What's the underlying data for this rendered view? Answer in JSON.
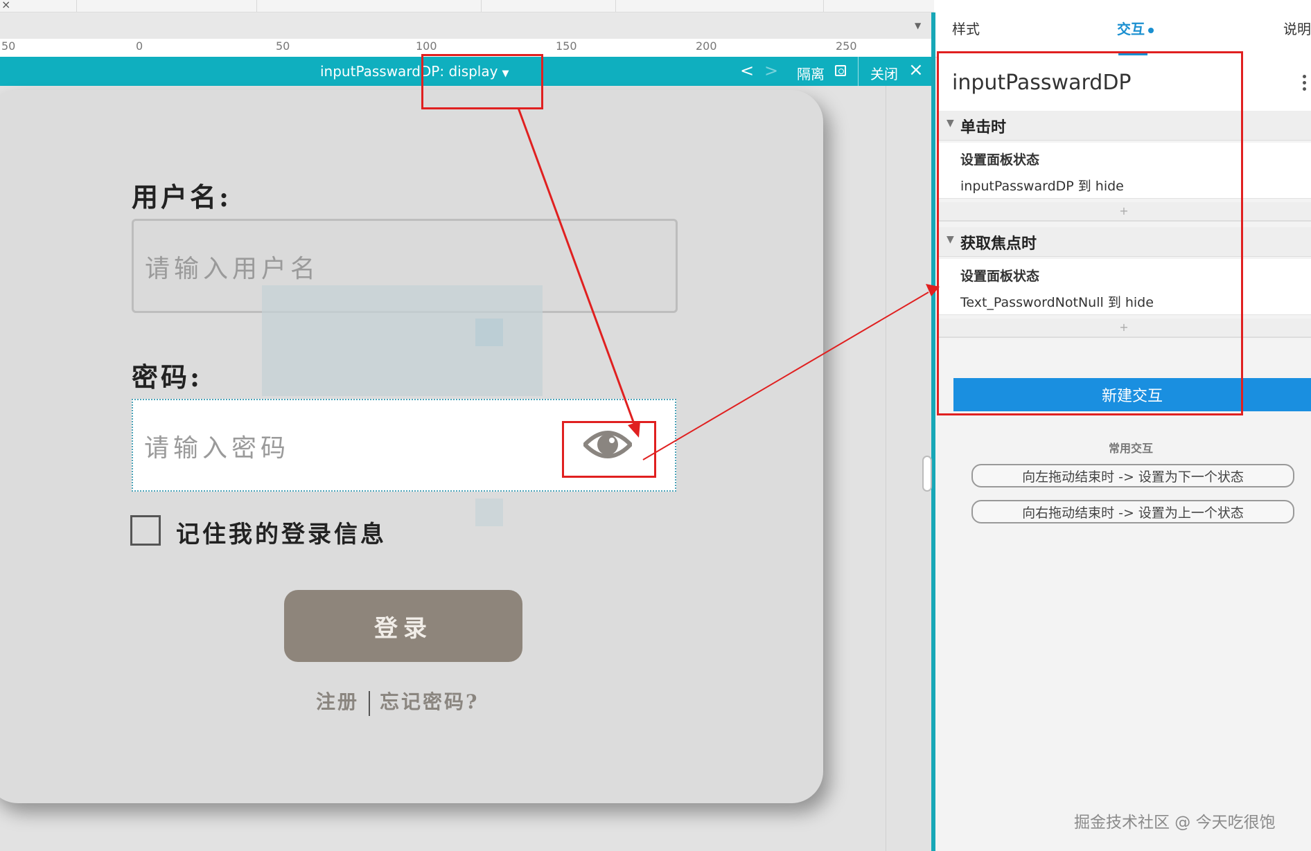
{
  "topbar": {
    "close_symbol": "×"
  },
  "ruler": {
    "labels": [
      "50",
      "0",
      "50",
      "100",
      "150",
      "200",
      "250"
    ]
  },
  "panel": {
    "title": "inputPasswardDP: display",
    "prev_symbol": "<",
    "next_symbol": ">",
    "isolate_label": "隔离",
    "close_label": "关闭",
    "close_symbol": "×"
  },
  "login_form": {
    "username_label": "用户名:",
    "username_placeholder": "请输入用户名",
    "password_label": "密码:",
    "password_placeholder": "请输入密码",
    "remember_label": "记住我的登录信息",
    "login_button": "登录",
    "register_link": "注册",
    "forgot_link": "忘记密码?"
  },
  "right_panel": {
    "tabs": [
      "样式",
      "交互",
      "说明"
    ],
    "active_tab": "交互",
    "widget_name": "inputPasswardDP",
    "events": [
      {
        "name": "单击时",
        "action_title": "设置面板状态",
        "action_desc": "inputPasswardDP 到 hide",
        "add_symbol": "+"
      },
      {
        "name": "获取焦点时",
        "action_title": "设置面板状态",
        "action_desc": "Text_PasswordNotNull 到 hide",
        "add_symbol": "+"
      }
    ],
    "new_interaction_button": "新建交互",
    "common_title": "常用交互",
    "common_items": [
      "向左拖动结束时 -> 设置为下一个状态",
      "向右拖动结束时 -> 设置为上一个状态"
    ]
  },
  "watermark": "掘金技术社区 @ 今天吃很饱",
  "colors": {
    "accent_teal": "#0fafbf",
    "accent_blue": "#1a8fe0",
    "highlight_red": "#e02020",
    "login_button": "#8e857b"
  }
}
